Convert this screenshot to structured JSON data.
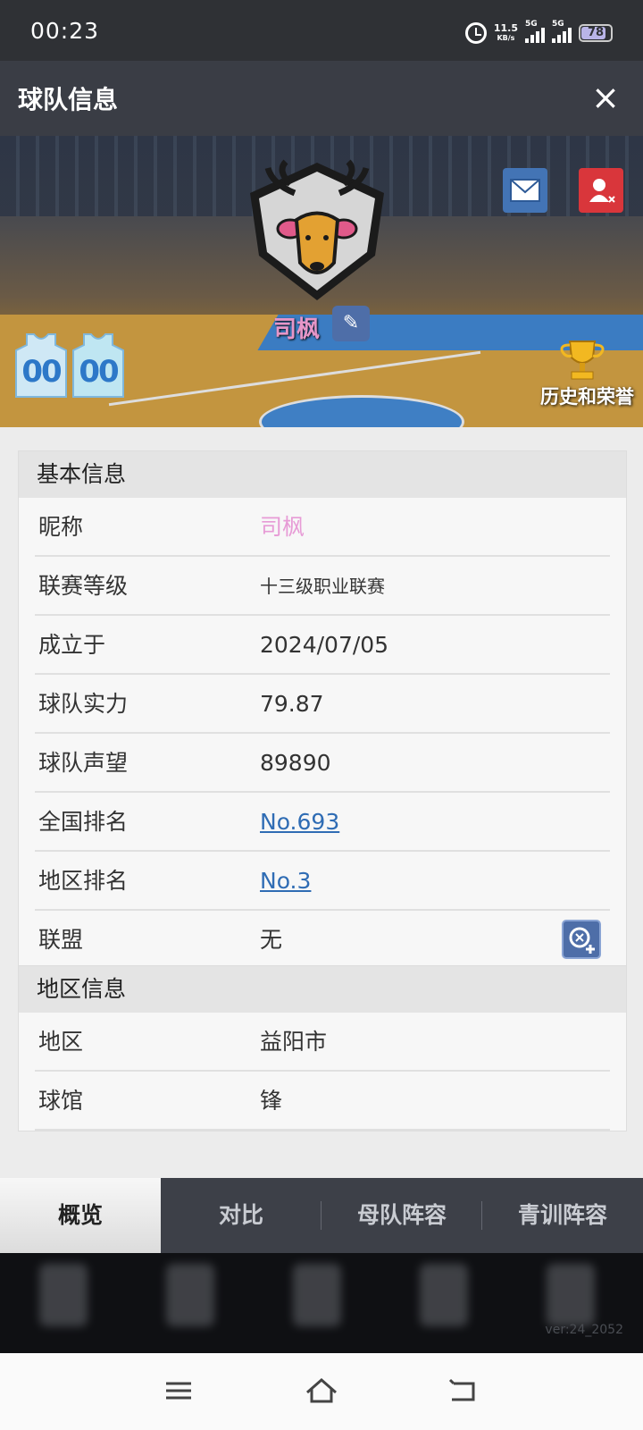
{
  "status_bar": {
    "time": "00:23",
    "net_speed": "11.5",
    "net_unit": "KB/s",
    "signal1": "5G",
    "signal2": "5G",
    "battery": "78"
  },
  "header": {
    "title": "球队信息",
    "close_icon": "×"
  },
  "banner": {
    "team_name": "司枫",
    "edit_icon": "✎",
    "jersey_number": "00",
    "history_label": "历史和荣誉",
    "colors": {
      "team_name": "#e79bd6",
      "mail": "#4374b5",
      "user": "#d9363b"
    }
  },
  "basic_info": {
    "title": "基本信息",
    "rows": [
      {
        "label": "昵称",
        "value": "司枫"
      },
      {
        "label": "联赛等级",
        "value": "十三级职业联赛"
      },
      {
        "label": "成立于",
        "value": "2024/07/05"
      },
      {
        "label": "球队实力",
        "value": "79.87"
      },
      {
        "label": "球队声望",
        "value": "89890"
      },
      {
        "label": "全国排名",
        "value": "No.693"
      },
      {
        "label": "地区排名",
        "value": "No.3"
      },
      {
        "label": "联盟",
        "value": "无"
      }
    ]
  },
  "region_info": {
    "title": "地区信息",
    "rows": [
      {
        "label": "地区",
        "value": "益阳市"
      },
      {
        "label": "球馆",
        "value": "锋"
      }
    ]
  },
  "tabs": [
    {
      "label": "概览",
      "active": true
    },
    {
      "label": "对比",
      "active": false
    },
    {
      "label": "母队阵容",
      "active": false
    },
    {
      "label": "青训阵容",
      "active": false
    }
  ],
  "version": "ver:24_2052"
}
